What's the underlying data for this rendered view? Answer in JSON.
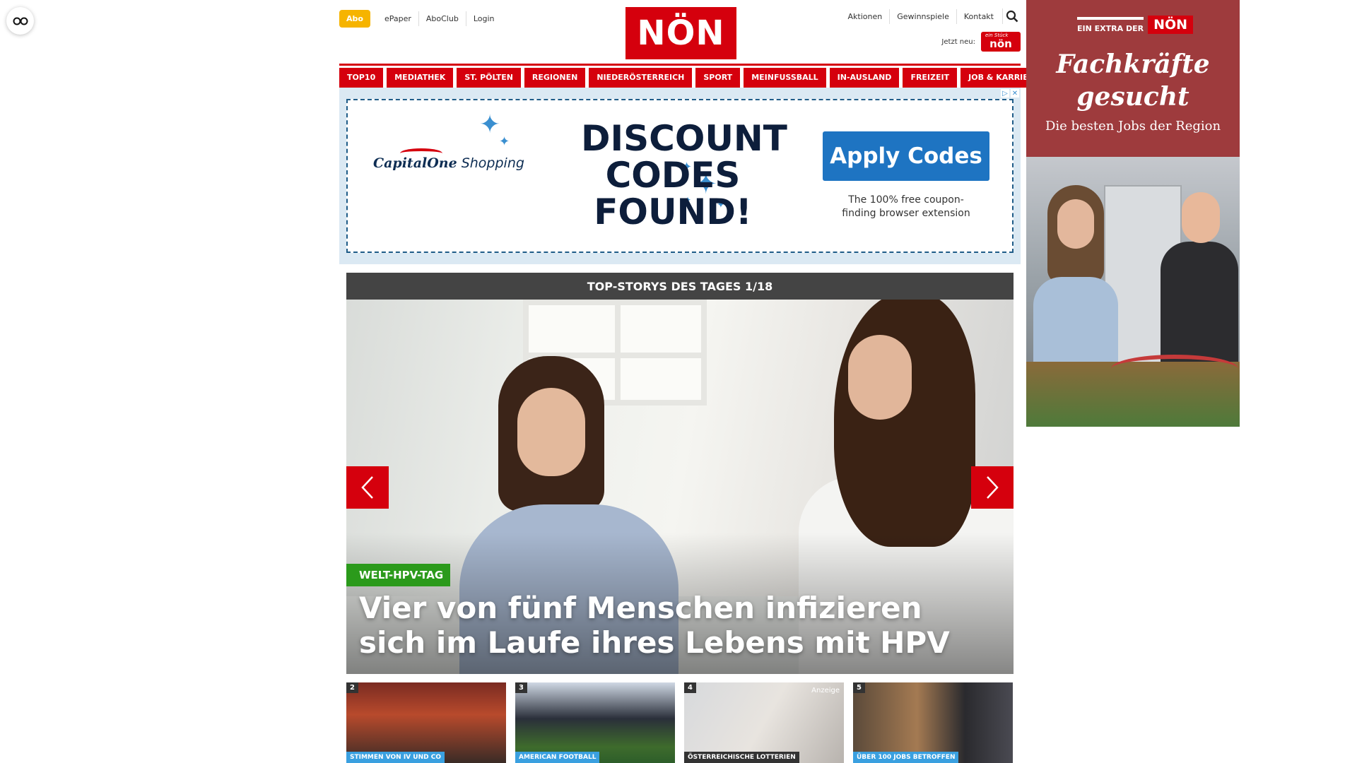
{
  "header": {
    "abo_label": "Abo",
    "left_links": [
      "ePaper",
      "AboClub",
      "Login"
    ],
    "logo_text": "NÖN",
    "right_links": [
      "Aktionen",
      "Gewinnspiele",
      "Kontakt"
    ],
    "jetzt_label": "Jetzt neu:",
    "mini_logo_small": "ein Stück",
    "mini_logo_text": "nön"
  },
  "nav": {
    "items": [
      "TOP10",
      "MEDIATHEK",
      "ST. PÖLTEN",
      "REGIONEN",
      "NIEDERÖSTERREICH",
      "SPORT",
      "MEINFUSSBALL",
      "IN-AUSLAND",
      "FREIZEIT",
      "JOB & KARRIERE"
    ]
  },
  "ad": {
    "brand_primary": "CapitalOne",
    "brand_secondary": "Shopping",
    "headline_lines": [
      "DISCOUNT",
      "CODES",
      "FOUND!"
    ],
    "cta_label": "Apply Codes",
    "subtext_lines": [
      "The 100% free coupon-",
      "finding browser extension"
    ]
  },
  "stories": {
    "heading": "TOP-STORYS DES TAGES 1/18",
    "hero": {
      "category": "WELT-HPV-TAG",
      "title": "Vier von fünf Menschen infizieren sich im Laufe ihres Lebens mit HPV"
    },
    "thumbs": [
      {
        "num": "2",
        "category": "STIMMEN VON IV UND CO",
        "ad": ""
      },
      {
        "num": "3",
        "category": "AMERICAN FOOTBALL",
        "ad": ""
      },
      {
        "num": "4",
        "category": "ÖSTERREICHISCHE LOTTERIEN",
        "ad": "Anzeige"
      },
      {
        "num": "5",
        "category": "ÜBER 100 JOBS BETROFFEN",
        "ad": ""
      }
    ]
  },
  "side_ad": {
    "extra_label": "EIN EXTRA DER",
    "logo_text": "NÖN",
    "headline_lines": [
      "Fachkräfte",
      "gesucht"
    ],
    "subline": "Die besten Jobs der Region"
  },
  "colors": {
    "brand_red": "#d5000d",
    "abo_yellow": "#f6b400",
    "hero_tag_green": "#2b9a1b",
    "ad_blue": "#1e74c2",
    "side_ad_red": "#9e3b3d"
  }
}
